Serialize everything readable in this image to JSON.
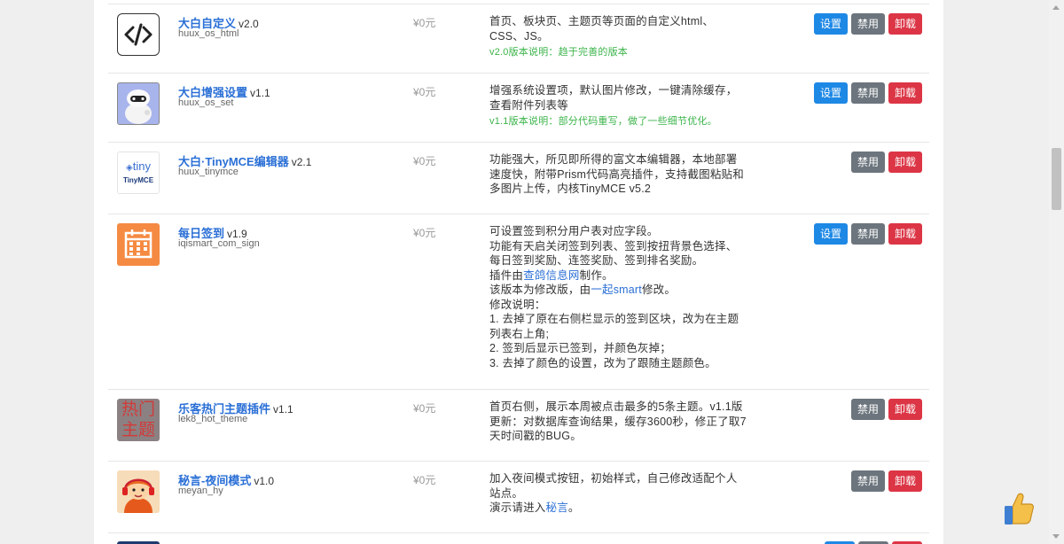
{
  "plugins": [
    {
      "name": "大白自定义",
      "version": "v2.0",
      "slug": "huux_os_html",
      "price": "¥0元",
      "desc": [
        "首页、板块页、主题页等页面的自定义html、CSS、JS。"
      ],
      "note": "v2.0版本说明：趋于完善的版本",
      "buttons": [
        "设置",
        "禁用",
        "卸载"
      ]
    },
    {
      "name": "大白增强设置",
      "version": "v1.1",
      "slug": "huux_os_set",
      "price": "¥0元",
      "desc": [
        "增强系统设置项，默认图片修改，一键清除缓存，查看附件列表等"
      ],
      "note": "v1.1版本说明：部分代码重写，做了一些细节优化。",
      "buttons": [
        "设置",
        "禁用",
        "卸载"
      ]
    },
    {
      "name": "大白·TinyMCE编辑器",
      "version": "v2.1",
      "slug": "huux_tinymce",
      "price": "¥0元",
      "desc": [
        "功能强大，所见即所得的富文本编辑器，本地部署速度快，附带Prism代码高亮插件，支持截图粘贴和多图片上传，内核TinyMCE v5.2"
      ],
      "buttons": [
        "禁用",
        "卸载"
      ],
      "logo_text": "tiny",
      "logo_sub": "TinyMCE"
    },
    {
      "name": "每日签到",
      "version": "v1.9",
      "slug": "iqismart_com_sign",
      "price": "¥0元",
      "desc": [
        "可设置签到积分用户表对应字段。",
        "功能有天启关闭签到列表、签到按扭背景色选择、每日签到奖励、连签奖励、签到排名奖励。"
      ],
      "desc_maker_pre": "插件由",
      "desc_maker_link": "查鸽信息网",
      "desc_maker_post": "制作。",
      "desc_mod_pre": "该版本为修改版，由",
      "desc_mod_link": "一起smart",
      "desc_mod_post": "修改。",
      "desc_changes": [
        "修改说明：",
        "1. 去掉了原在右侧栏显示的签到区块，改为在主题列表右上角;",
        "2. 签到后显示已签到，并颜色灰掉；",
        "3. 去掉了颜色的设置，改为了跟随主题颜色。"
      ],
      "buttons": [
        "设置",
        "禁用",
        "卸载"
      ]
    },
    {
      "name": "乐客热门主题插件",
      "version": "v1.1",
      "slug": "lek8_hot_theme",
      "price": "¥0元",
      "desc": [
        "首页右侧，展示本周被点击最多的5条主题。v1.1版更新：对数据库查询结果，缓存3600秒，修正了取7天时间戳的BUG。"
      ],
      "buttons": [
        "禁用",
        "卸载"
      ],
      "logo_text_1": "热门",
      "logo_text_2": "主题"
    },
    {
      "name": "秘言-夜间模式",
      "version": "v1.0",
      "slug": "meyan_hy",
      "price": "¥0元",
      "desc": [
        "加入夜间模式按钮，初始样式，自己修改适配个人站点。"
      ],
      "desc_demo_pre": "演示请进入",
      "desc_demo_link": "秘言",
      "desc_demo_post": "。",
      "buttons": [
        "禁用",
        "卸载"
      ]
    }
  ],
  "colors": {
    "link": "#2a6fd6",
    "note": "#3cb44b",
    "primary": "#1e88e5",
    "secondary": "#6c757d",
    "danger": "#dc3545"
  }
}
